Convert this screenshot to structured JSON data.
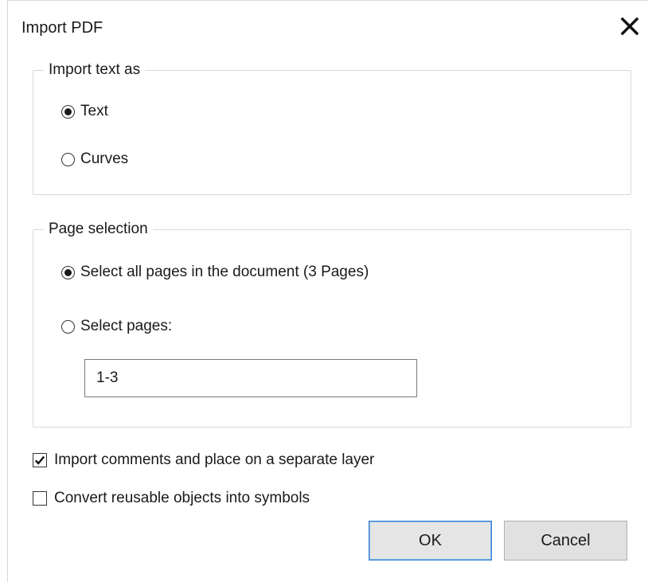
{
  "dialog": {
    "title": "Import PDF",
    "close_icon": "close-icon"
  },
  "import_text_group": {
    "legend": "Import text as",
    "options": [
      {
        "label": "Text",
        "selected": true
      },
      {
        "label": "Curves",
        "selected": false
      }
    ]
  },
  "page_selection_group": {
    "legend": "Page selection",
    "options": [
      {
        "label": "Select all pages in the document (3 Pages)",
        "selected": true
      },
      {
        "label": "Select pages:",
        "selected": false
      }
    ],
    "pages_input_value": "1-3"
  },
  "checkboxes": [
    {
      "label": "Import comments and place on a separate layer",
      "checked": true
    },
    {
      "label": "Convert reusable objects into symbols",
      "checked": false
    }
  ],
  "buttons": {
    "ok_label": "OK",
    "cancel_label": "Cancel"
  },
  "colors": {
    "ok_border": "#2f7fd6",
    "group_border": "#d9d9d9"
  }
}
